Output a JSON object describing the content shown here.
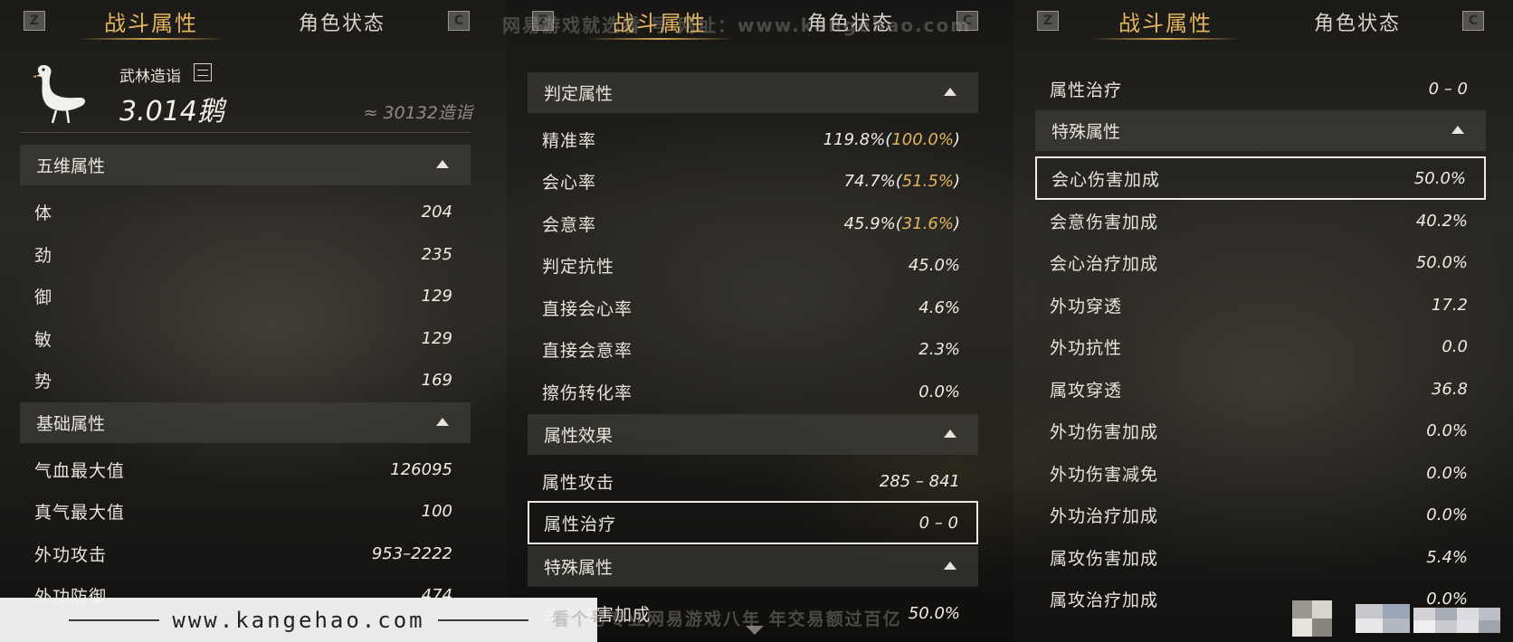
{
  "panels": [
    {
      "tabs": {
        "key_left": "Z",
        "active": "战斗属性",
        "inactive": "角色状态",
        "key_right": "C"
      },
      "profile": {
        "label": "武林造诣",
        "score": "3.014鹅",
        "approx": "≈ 30132造诣"
      },
      "sections": [
        {
          "title": "五维属性",
          "rows": [
            {
              "label": "体",
              "value": "204"
            },
            {
              "label": "劲",
              "value": "235"
            },
            {
              "label": "御",
              "value": "129"
            },
            {
              "label": "敏",
              "value": "129"
            },
            {
              "label": "势",
              "value": "169"
            }
          ]
        },
        {
          "title": "基础属性",
          "rows": [
            {
              "label": "气血最大值",
              "value": "126095"
            },
            {
              "label": "真气最大值",
              "value": "100"
            },
            {
              "label": "外功攻击",
              "value": "953–2222"
            },
            {
              "label": "外功防御",
              "value": "474"
            }
          ]
        }
      ]
    },
    {
      "tabs": {
        "key_left": "Z",
        "active": "战斗属性",
        "inactive": "角色状态",
        "key_right": "C"
      },
      "sections": [
        {
          "title": "判定属性",
          "rows": [
            {
              "label": "精准率",
              "value": "119.8%(",
              "highlight": "100.0%",
              "suffix": ")"
            },
            {
              "label": "会心率",
              "value": "74.7%(",
              "highlight": "51.5%",
              "suffix": ")"
            },
            {
              "label": "会意率",
              "value": "45.9%(",
              "highlight": "31.6%",
              "suffix": ")"
            },
            {
              "label": "判定抗性",
              "value": "45.0%"
            },
            {
              "label": "直接会心率",
              "value": "4.6%"
            },
            {
              "label": "直接会意率",
              "value": "2.3%"
            },
            {
              "label": "擦伤转化率",
              "value": "0.0%"
            }
          ]
        },
        {
          "title": "属性效果",
          "rows": [
            {
              "label": "属性攻击",
              "value": "285 – 841"
            },
            {
              "label": "属性治疗",
              "value": "0 – 0"
            }
          ]
        },
        {
          "title": "特殊属性",
          "rows": [
            {
              "label": "会心伤害加成",
              "value": "50.0%"
            }
          ]
        }
      ]
    },
    {
      "tabs": {
        "key_left": "Z",
        "active": "战斗属性",
        "inactive": "角色状态",
        "key_right": "C"
      },
      "top_row": {
        "label": "属性治疗",
        "value": "0 – 0"
      },
      "sections": [
        {
          "title": "特殊属性",
          "rows": [
            {
              "label": "会心伤害加成",
              "value": "50.0%"
            },
            {
              "label": "会意伤害加成",
              "value": "40.2%"
            },
            {
              "label": "会心治疗加成",
              "value": "50.0%"
            },
            {
              "label": "外功穿透",
              "value": "17.2"
            },
            {
              "label": "外功抗性",
              "value": "0.0"
            },
            {
              "label": "属攻穿透",
              "value": "36.8"
            },
            {
              "label": "外功伤害加成",
              "value": "0.0%"
            },
            {
              "label": "外功伤害减免",
              "value": "0.0%"
            },
            {
              "label": "外功治疗加成",
              "value": "0.0%"
            },
            {
              "label": "属攻伤害加成",
              "value": "5.4%"
            },
            {
              "label": "属攻治疗加成",
              "value": "0.0%"
            }
          ]
        }
      ]
    }
  ],
  "watermark_top": "网易游戏就选看 号 网址：www.kangehao.com",
  "footer": {
    "url": "www.kangehao.com",
    "slogan": "看个号专业网易游戏八年  年交易额过百亿"
  }
}
